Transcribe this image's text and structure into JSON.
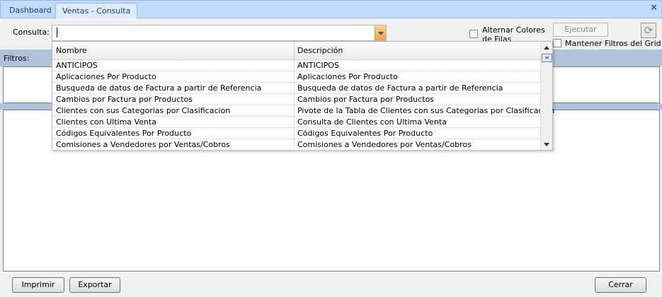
{
  "tabs": [
    {
      "label": "Dashboard"
    },
    {
      "label": "Ventas - Consulta",
      "active": true
    }
  ],
  "toolbar": {
    "consulta_label": "Consulta:",
    "consulta_value": "",
    "alternar_label": "Alternar Colores de Filas",
    "alternar_checked": false,
    "ejecutar_label": "Ejecutar",
    "mantener_label": "Mantener Filtros del Grid",
    "mantener_checked": false,
    "refresh_icon": "refresh-clock-icon"
  },
  "filters": {
    "label": "Filtros:"
  },
  "dropdown": {
    "columns": [
      "Nombre",
      "Descripción"
    ],
    "rows": [
      [
        "ANTICIPOS",
        "ANTICIPOS"
      ],
      [
        "Aplicaciones Por Producto",
        "Aplicaciones Por Producto"
      ],
      [
        "Busqueda de datos de Factura a partir de Referencia",
        "Busqueda de datos de Factura a partir de Referencia"
      ],
      [
        "Cambios por Factura por Productos",
        "Cambios por Factura por Productos"
      ],
      [
        "Clientes con sus Categorias por Clasificacion",
        "Pivote de la Tabla de Clientes con sus Categorias por Clasificacion"
      ],
      [
        "Clientes con Ultima Venta",
        "Consulta de Clientes con Ultima Venta"
      ],
      [
        "Códigos Equivalentes Por Producto",
        "Códigos Equivalentes Por Producto"
      ],
      [
        "Comisiones a Vendedores por Ventas/Cobros",
        "Comisiones a Vendedores por Ventas/Cobros"
      ]
    ]
  },
  "footer": {
    "imprimir": "Imprimir",
    "exportar": "Exportar",
    "cerrar": "Cerrar"
  },
  "colors": {
    "tabbar": "#c2dafc",
    "panel_header": "#afc4dc",
    "combo_arrow": "#f2a33a"
  }
}
